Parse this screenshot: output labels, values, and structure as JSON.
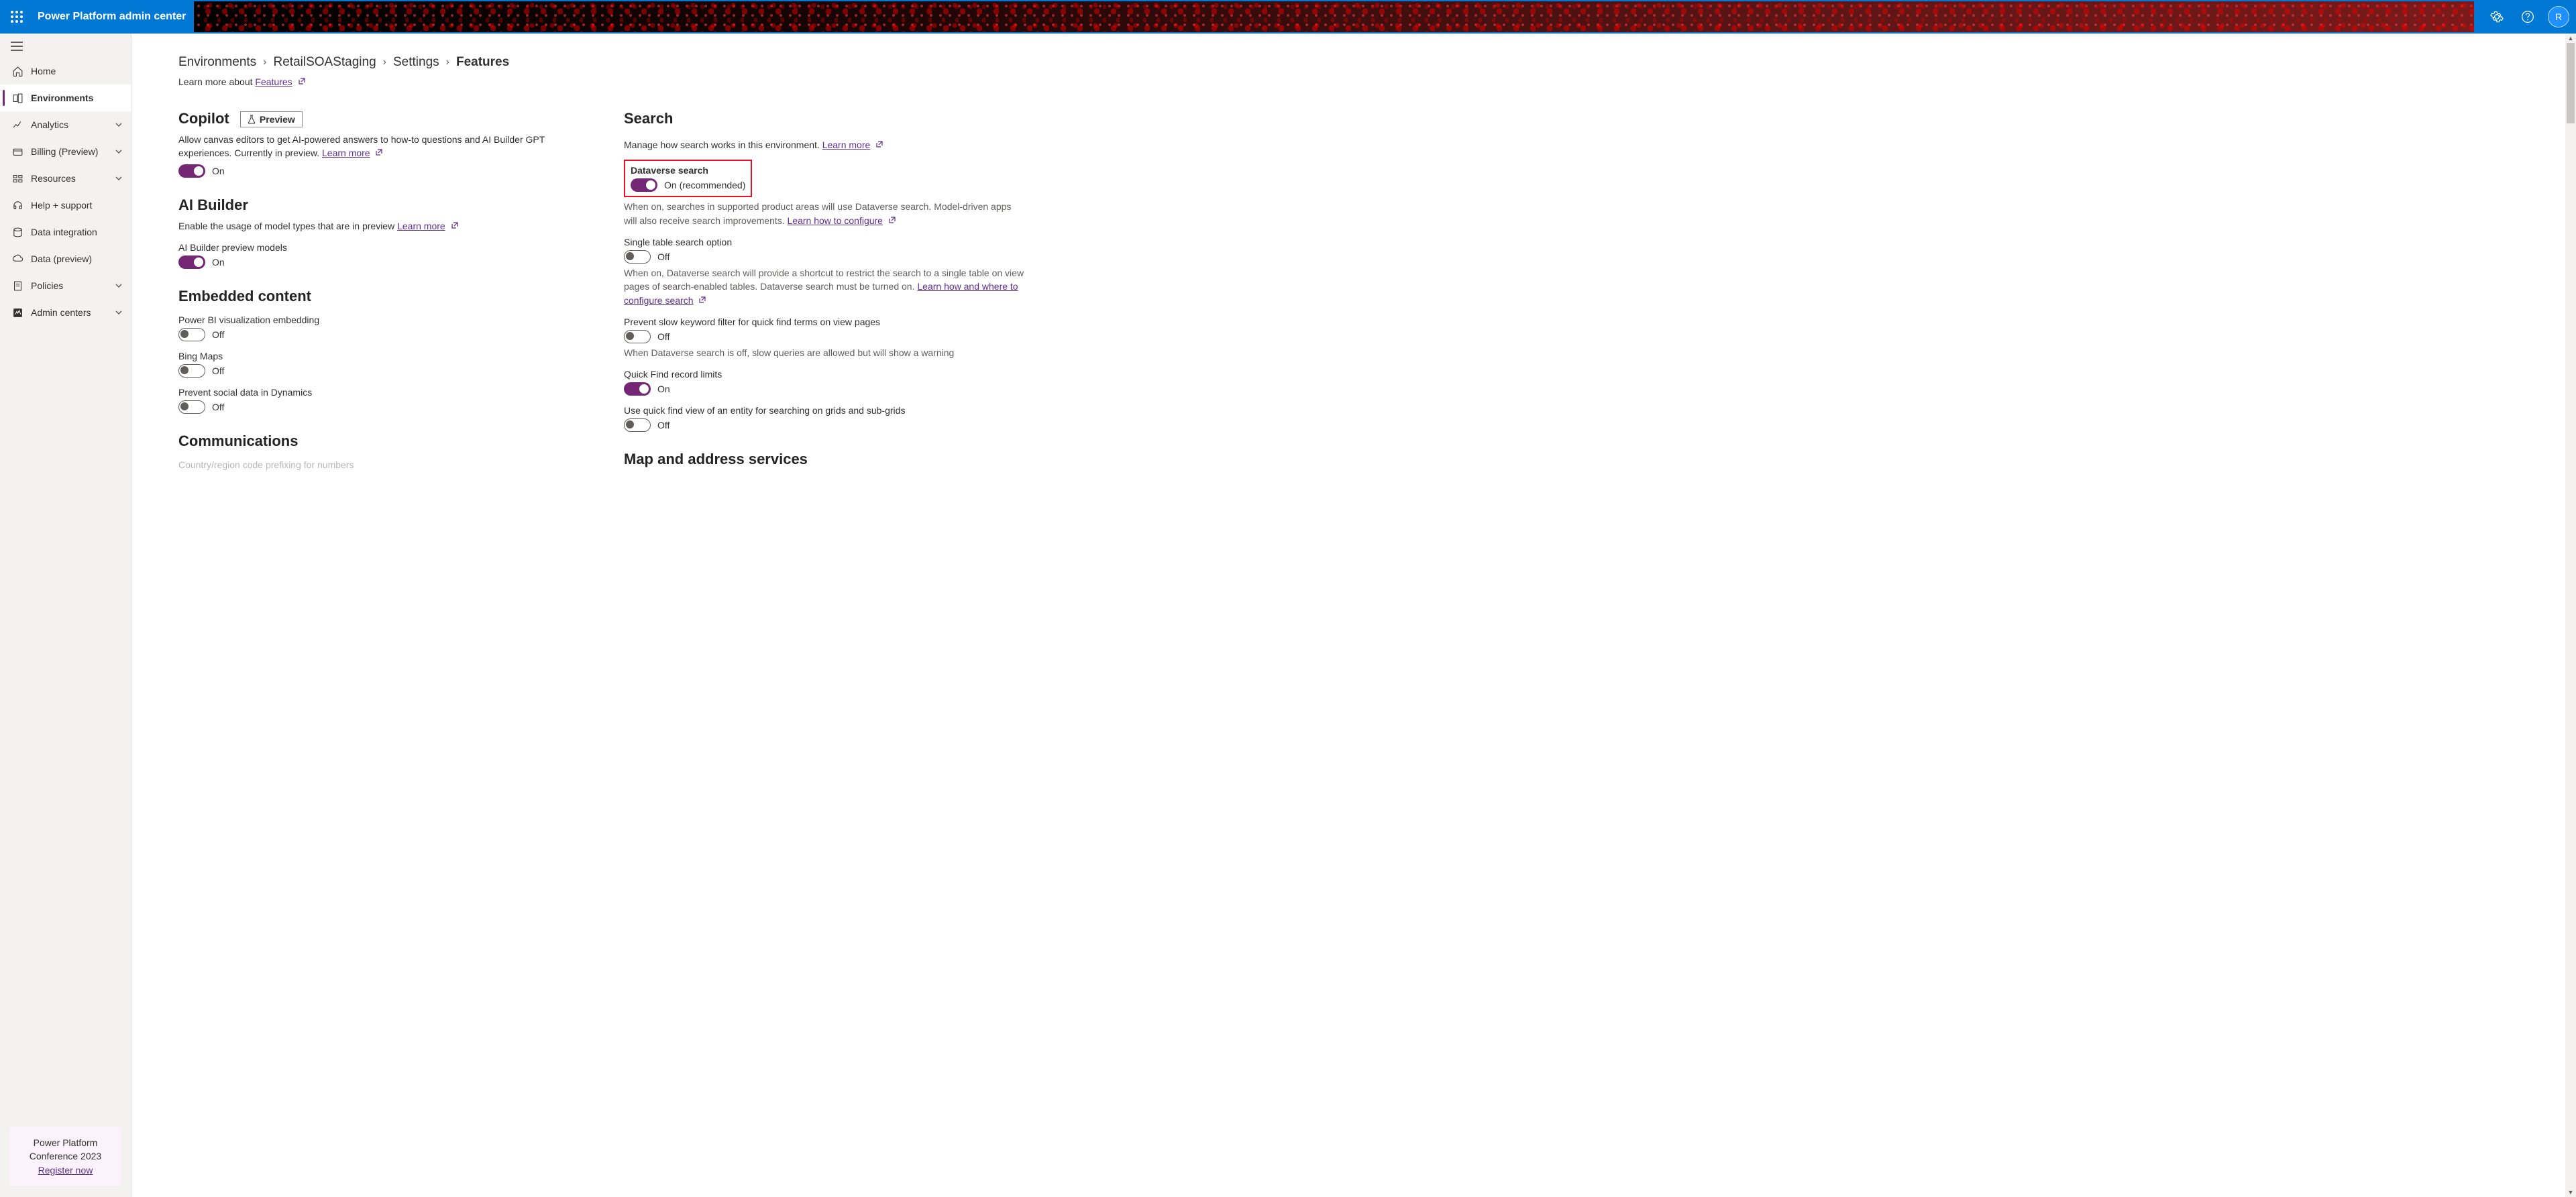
{
  "header": {
    "app_title": "Power Platform admin center",
    "avatar_initial": "R"
  },
  "sidebar": {
    "items": [
      {
        "label": "Home"
      },
      {
        "label": "Environments"
      },
      {
        "label": "Analytics"
      },
      {
        "label": "Billing (Preview)"
      },
      {
        "label": "Resources"
      },
      {
        "label": "Help + support"
      },
      {
        "label": "Data integration"
      },
      {
        "label": "Data (preview)"
      },
      {
        "label": "Policies"
      },
      {
        "label": "Admin centers"
      }
    ],
    "promo": {
      "line": "Power Platform Conference 2023",
      "link": "Register now"
    }
  },
  "breadcrumb": {
    "items": [
      "Environments",
      "RetailSOAStaging",
      "Settings",
      "Features"
    ]
  },
  "learn_more_prefix": "Learn more about ",
  "learn_more_link": "Features",
  "col_left": {
    "copilot": {
      "title": "Copilot",
      "badge": "Preview",
      "desc": "Allow canvas editors to get AI-powered answers to how-to questions and AI Builder GPT experiences. Currently in preview. ",
      "learn_more": "Learn more",
      "toggle_label": "On"
    },
    "ai_builder": {
      "title": "AI Builder",
      "desc": "Enable the usage of model types that are in preview ",
      "learn_more": "Learn more",
      "setting1_label": "AI Builder preview models",
      "toggle_label": "On"
    },
    "embedded": {
      "title": "Embedded content",
      "powerbi_label": "Power BI visualization embedding",
      "powerbi_toggle": "Off",
      "bing_label": "Bing Maps",
      "bing_toggle": "Off",
      "social_label": "Prevent social data in Dynamics",
      "social_toggle": "Off"
    },
    "communications": {
      "title": "Communications",
      "cut_line": "Country/region code prefixing for numbers"
    }
  },
  "col_right": {
    "search": {
      "title": "Search",
      "desc": "Manage how search works in this environment. ",
      "learn_more": "Learn more",
      "dataverse_label": "Dataverse search",
      "dataverse_toggle": "On (recommended)",
      "dataverse_desc": "When on, searches in supported product areas will use Dataverse search. Model-driven apps will also receive search improvements. ",
      "dataverse_link": "Learn how to configure",
      "single_label": "Single table search option",
      "single_toggle": "Off",
      "single_desc": "When on, Dataverse search will provide a shortcut to restrict the search to a single table on view pages of search-enabled tables. Dataverse search must be turned on. ",
      "single_link": "Learn how and where to configure search",
      "prevent_label": "Prevent slow keyword filter for quick find terms on view pages",
      "prevent_toggle": "Off",
      "prevent_desc": "When Dataverse search is off, slow queries are allowed but will show a warning",
      "quickfind_label": "Quick Find record limits",
      "quickfind_toggle": "On",
      "usequick_label": "Use quick find view of an entity for searching on grids and sub-grids",
      "usequick_toggle": "Off"
    },
    "map_services": {
      "title": "Map and address services"
    }
  }
}
